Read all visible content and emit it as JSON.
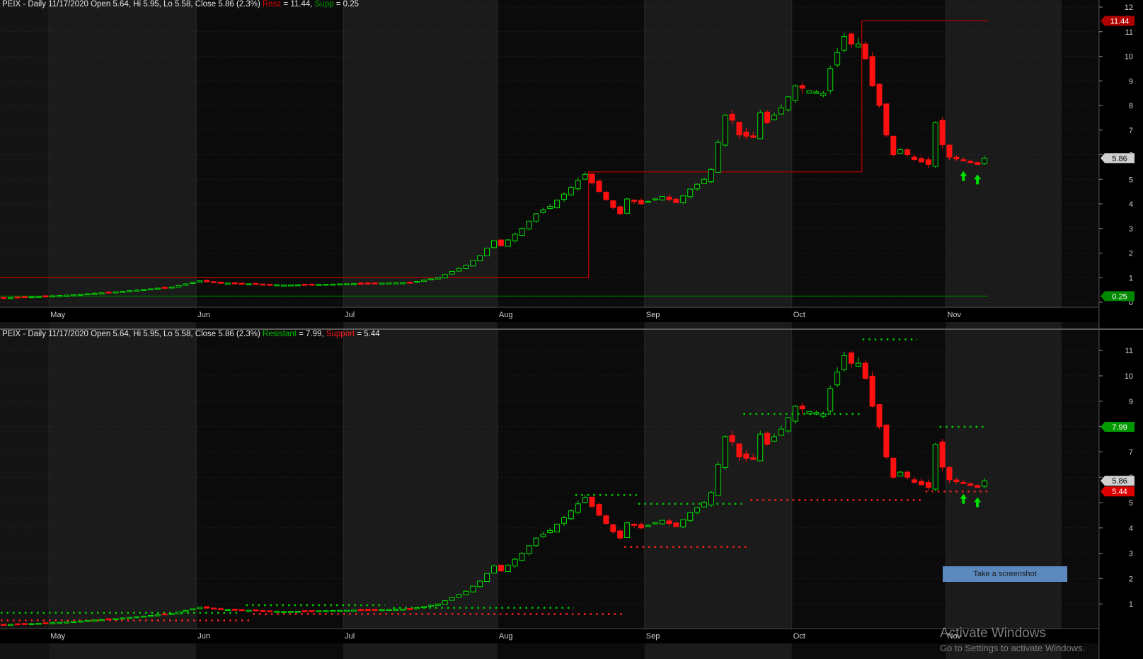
{
  "panes": [
    {
      "id": "top",
      "title_prefix": "PEIX - Daily 11/17/2020 Open 5.64, Hi 5.95, Lo 5.58, Close 5.86 (2.3%)",
      "res_label": "Resz",
      "res_value": " = 11.44, ",
      "sup_label": "Supp",
      "sup_value": " = 0.25",
      "badges": [
        {
          "text": "11.44",
          "value": 11.44,
          "bg": "#b00000",
          "fg": "#ffffff"
        },
        {
          "text": "5.86",
          "value": 5.86,
          "bg": "#d0d0d0",
          "fg": "#000000"
        },
        {
          "text": "0.25",
          "value": 0.25,
          "bg": "#008800",
          "fg": "#ffffff"
        }
      ]
    },
    {
      "id": "bottom",
      "title_prefix": "PEIX - Daily 11/17/2020 Open 5.64, Hi 5.95, Lo 5.58, Close 5.86 (2.3%)",
      "res_label": "Resistant",
      "res_value": " = 7.99, ",
      "sup_label": "Support",
      "sup_value": " = 5.44",
      "badges": [
        {
          "text": "7.99",
          "value": 7.99,
          "bg": "#009900",
          "fg": "#ffffff"
        },
        {
          "text": "5.86",
          "value": 5.86,
          "bg": "#d0d0d0",
          "fg": "#000000"
        },
        {
          "text": "5.44",
          "value": 5.44,
          "bg": "#dd0000",
          "fg": "#ffffff"
        }
      ]
    }
  ],
  "screenshot_button": "Take a screenshot",
  "watermark": {
    "line1": "Activate Windows",
    "line2": "Go to Settings to activate Windows."
  },
  "colors": {
    "up": "#00e000",
    "down": "#ff1010",
    "res_line": "#c00000",
    "sup_line": "#007a00"
  },
  "chart_data": {
    "type": "candlestick",
    "symbol": "PEIX",
    "timeframe": "Daily",
    "ylim_top": [
      0,
      12
    ],
    "ylim_bottom": [
      0,
      12
    ],
    "y_ticks": [
      0,
      1,
      2,
      3,
      4,
      5,
      6,
      7,
      8,
      9,
      10,
      11,
      12
    ],
    "months": [
      {
        "label": "May",
        "idx": 7
      },
      {
        "label": "Jun",
        "idx": 28
      },
      {
        "label": "Jul",
        "idx": 49
      },
      {
        "label": "Aug",
        "idx": 71
      },
      {
        "label": "Sep",
        "idx": 92
      },
      {
        "label": "Oct",
        "idx": 113
      },
      {
        "label": "Nov",
        "idx": 135
      }
    ],
    "keys": [
      [
        0,
        0.18
      ],
      [
        8,
        0.27
      ],
      [
        16,
        0.42
      ],
      [
        24,
        0.62
      ],
      [
        28,
        0.87
      ],
      [
        30,
        0.8
      ],
      [
        40,
        0.7
      ],
      [
        49,
        0.75
      ],
      [
        58,
        0.8
      ],
      [
        62,
        1.0
      ],
      [
        64,
        1.25
      ],
      [
        66,
        1.5
      ],
      [
        68,
        1.9
      ],
      [
        70,
        2.5
      ],
      [
        71,
        2.3
      ],
      [
        74,
        3.0
      ],
      [
        76,
        3.6
      ],
      [
        78,
        3.9
      ],
      [
        80,
        4.4
      ],
      [
        82,
        4.95
      ],
      [
        83,
        5.2
      ],
      [
        85,
        4.5
      ],
      [
        87,
        3.85
      ],
      [
        88,
        3.6
      ],
      [
        89,
        4.2
      ],
      [
        91,
        4.0
      ],
      [
        94,
        4.3
      ],
      [
        96,
        4.05
      ],
      [
        98,
        4.6
      ],
      [
        100,
        5.0
      ],
      [
        101,
        5.4
      ],
      [
        103,
        7.6
      ],
      [
        104,
        7.4
      ],
      [
        105,
        6.8
      ],
      [
        107,
        6.7
      ],
      [
        108,
        7.7
      ],
      [
        109,
        7.3
      ],
      [
        111,
        7.9
      ],
      [
        113,
        8.8
      ],
      [
        115,
        8.6
      ],
      [
        117,
        8.5
      ],
      [
        118,
        9.5
      ],
      [
        120,
        10.8
      ],
      [
        121,
        10.5
      ],
      [
        122,
        10.5
      ],
      [
        123,
        9.9
      ],
      [
        124,
        8.8
      ],
      [
        125,
        8.0
      ],
      [
        126,
        6.8
      ],
      [
        127,
        6.0
      ],
      [
        128,
        6.2
      ],
      [
        129,
        6.0
      ],
      [
        130,
        5.8
      ],
      [
        132,
        5.6
      ],
      [
        133,
        7.3
      ],
      [
        134,
        6.4
      ],
      [
        135,
        5.9
      ],
      [
        137,
        5.75
      ],
      [
        139,
        5.6
      ],
      [
        140,
        5.85
      ]
    ],
    "arrows_idx": [
      137,
      139
    ],
    "top_overlay": {
      "resistance_steps": [
        {
          "from": 0,
          "to": 83,
          "value": 1.0
        },
        {
          "from": 84,
          "to": 122,
          "value": 5.3
        },
        {
          "from": 123,
          "to": 140,
          "value": 11.44
        }
      ],
      "support_level": 0.25
    },
    "bottom_levels": {
      "resistance": [
        {
          "from": 0,
          "to": 33,
          "value": 0.65
        },
        {
          "from": 35,
          "to": 54,
          "value": 0.95
        },
        {
          "from": 56,
          "to": 81,
          "value": 0.85
        },
        {
          "from": 82,
          "to": 90,
          "value": 5.3
        },
        {
          "from": 91,
          "to": 105,
          "value": 4.95
        },
        {
          "from": 106,
          "to": 122,
          "value": 8.5
        },
        {
          "from": 123,
          "to": 130,
          "value": 11.44
        },
        {
          "from": 134,
          "to": 140,
          "value": 7.99
        }
      ],
      "support": [
        {
          "from": 0,
          "to": 35,
          "value": 0.35
        },
        {
          "from": 36,
          "to": 88,
          "value": 0.6
        },
        {
          "from": 89,
          "to": 106,
          "value": 3.25
        },
        {
          "from": 107,
          "to": 131,
          "value": 5.1
        },
        {
          "from": 132,
          "to": 140,
          "value": 5.44
        }
      ]
    }
  }
}
